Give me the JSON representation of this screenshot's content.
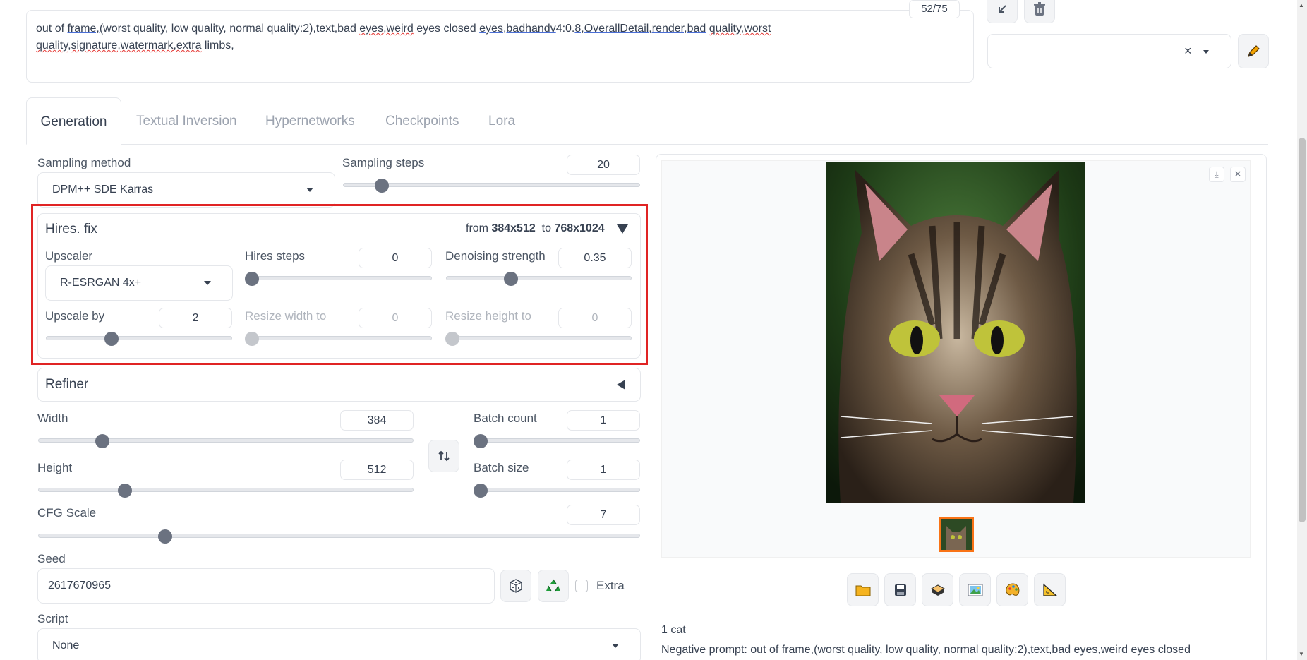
{
  "negative_prompt": {
    "line1_parts": [
      {
        "t": "out of ",
        "s": ""
      },
      {
        "t": "frame,(",
        "s": "b"
      },
      {
        "t": "worst quality, low quality, normal quality:2),text,bad ",
        "s": ""
      },
      {
        "t": "eyes,weird",
        "s": "u"
      },
      {
        "t": " eyes closed ",
        "s": ""
      },
      {
        "t": "eyes,badhandv",
        "s": "b"
      },
      {
        "t": "4:0.",
        "s": ""
      },
      {
        "t": "8,OverallDetail,render,bad",
        "s": "b"
      },
      {
        "t": " ",
        "s": ""
      },
      {
        "t": "quality,worst",
        "s": "u"
      }
    ],
    "line2_parts": [
      {
        "t": "quality,signature,watermark,extra",
        "s": "u"
      },
      {
        "t": " limbs,",
        "s": ""
      }
    ],
    "token_count": "52/75"
  },
  "top_tools": {
    "arrow_icon": "arrow-down-left-icon",
    "trash_icon": "trash-icon",
    "clear_x": "×",
    "edit_icon": "pencil-icon"
  },
  "tabs": [
    "Generation",
    "Textual Inversion",
    "Hypernetworks",
    "Checkpoints",
    "Lora"
  ],
  "sampling": {
    "method_label": "Sampling method",
    "method_value": "DPM++ SDE Karras",
    "steps_label": "Sampling steps",
    "steps_value": "20",
    "steps_fraction": 0.13
  },
  "hires": {
    "title": "Hires. fix",
    "from_label": "from",
    "from_value": "384x512",
    "to_label": "to",
    "to_value": "768x1024",
    "upscaler_label": "Upscaler",
    "upscaler_value": "R-ESRGAN 4x+",
    "hires_steps_label": "Hires steps",
    "hires_steps_value": "0",
    "hires_steps_fraction": 0.0,
    "denoise_label": "Denoising strength",
    "denoise_value": "0.35",
    "denoise_fraction": 0.35,
    "upscale_by_label": "Upscale by",
    "upscale_by_value": "2",
    "upscale_by_fraction": 0.35,
    "resize_w_label": "Resize width to",
    "resize_w_value": "0",
    "resize_h_label": "Resize height to",
    "resize_h_value": "0"
  },
  "refiner": {
    "title": "Refiner"
  },
  "dims": {
    "width_label": "Width",
    "width_value": "384",
    "width_fraction": 0.17,
    "height_label": "Height",
    "height_value": "512",
    "height_fraction": 0.23,
    "batch_count_label": "Batch count",
    "batch_count_value": "1",
    "batch_size_label": "Batch size",
    "batch_size_value": "1",
    "swap_icon": "swap-vertical-icon"
  },
  "cfg": {
    "label": "CFG Scale",
    "value": "7",
    "fraction": 0.21
  },
  "seed": {
    "label": "Seed",
    "value": "2617670965",
    "extra_label": "Extra"
  },
  "script": {
    "label": "Script",
    "value": "None"
  },
  "output": {
    "tool_icons": [
      "folder-icon",
      "save-icon",
      "zip-icon",
      "image-icon",
      "palette-icon",
      "ruler-icon"
    ],
    "prompt_text": "1 cat",
    "negative_text": "Negative prompt: out of frame,(worst quality, low quality, normal quality:2),text,bad eyes,weird eyes closed"
  }
}
